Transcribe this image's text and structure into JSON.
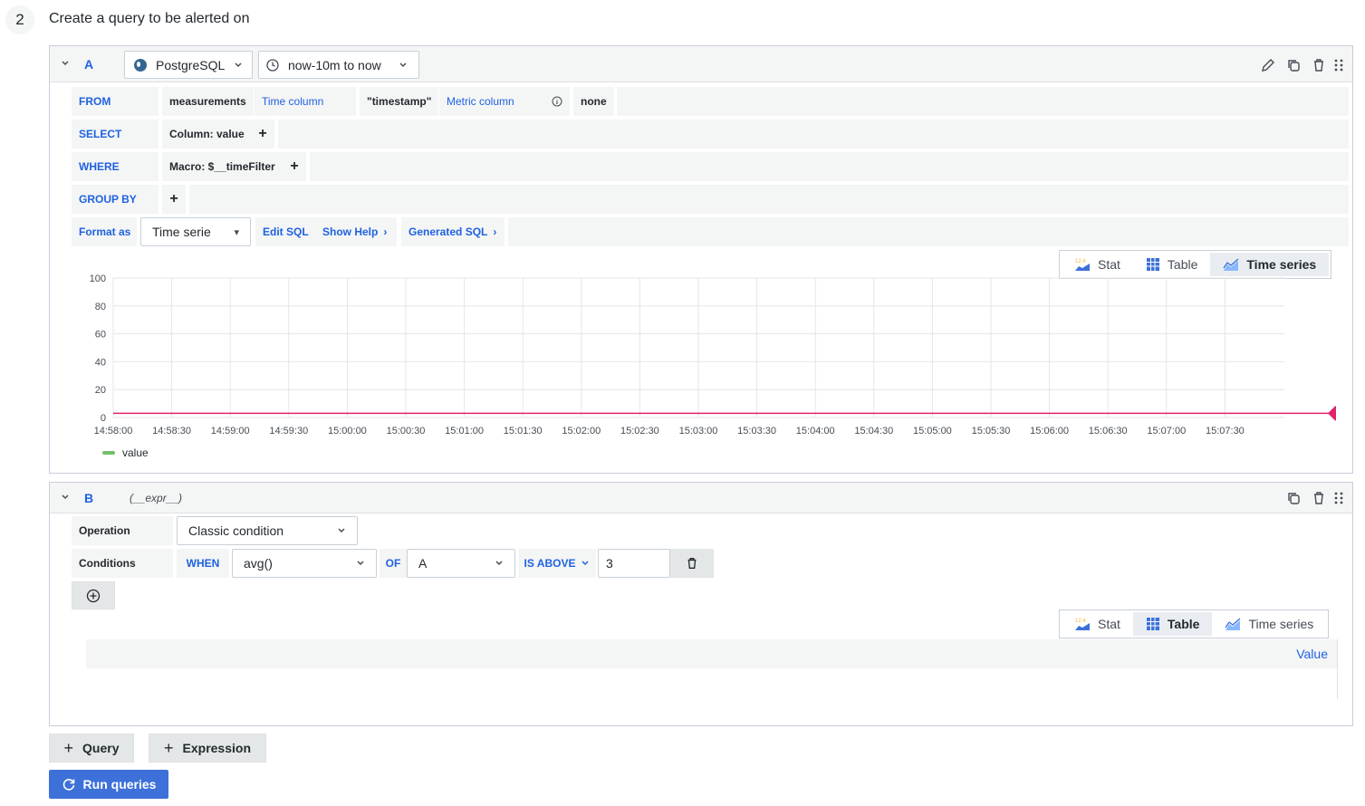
{
  "step": {
    "number": "2",
    "title": "Create a query to be alerted on"
  },
  "queryA": {
    "name": "A",
    "datasource": "PostgreSQL",
    "time_range": "now-10m to now",
    "from_label": "FROM",
    "from_table": "measurements",
    "time_column_label": "Time column",
    "time_column_value": "\"timestamp\"",
    "metric_column_label": "Metric column",
    "metric_column_value": "none",
    "select_label": "SELECT",
    "select_value": "Column: value",
    "where_label": "WHERE",
    "where_value": "Macro: $__timeFilter",
    "group_by_label": "GROUP BY",
    "format_as_label": "Format as",
    "format_as_value": "Time serie",
    "edit_sql": "Edit SQL",
    "show_help": "Show Help",
    "generated_sql": "Generated SQL",
    "plus": "+",
    "view_tabs": [
      "Stat",
      "Table",
      "Time series"
    ],
    "active_view": "Time series"
  },
  "chart_data": {
    "type": "line",
    "y_ticks": [
      "100",
      "80",
      "60",
      "40",
      "20",
      "0"
    ],
    "ylim": [
      0,
      100
    ],
    "x_ticks": [
      "14:58:00",
      "14:58:30",
      "14:59:00",
      "14:59:30",
      "15:00:00",
      "15:00:30",
      "15:01:00",
      "15:01:30",
      "15:02:00",
      "15:02:30",
      "15:03:00",
      "15:03:30",
      "15:04:00",
      "15:04:30",
      "15:05:00",
      "15:05:30",
      "15:06:00",
      "15:06:30",
      "15:07:00",
      "15:07:30"
    ],
    "series": [
      {
        "name": "value",
        "color": "#73bf69",
        "values": []
      }
    ],
    "threshold": {
      "value": 3,
      "label": "3",
      "color": "#e0226e"
    },
    "legend": "bottom-left",
    "grid": true
  },
  "queryB": {
    "name": "B",
    "expr": "(__expr__)",
    "operation_label": "Operation",
    "operation_value": "Classic condition",
    "conditions_label": "Conditions",
    "when": "WHEN",
    "func": "avg()",
    "of": "OF",
    "query_ref": "A",
    "is_above": "IS ABOVE",
    "threshold": "3",
    "view_tabs": [
      "Stat",
      "Table",
      "Time series"
    ],
    "active_view": "Table",
    "table_header": "Value"
  },
  "buttons": {
    "add_query": "Query",
    "add_expression": "Expression",
    "run_queries": "Run queries"
  },
  "colors": {
    "accent": "#1f62e0",
    "primary": "#3d71d9",
    "threshold": "#e0226e",
    "series": "#73bf69"
  }
}
